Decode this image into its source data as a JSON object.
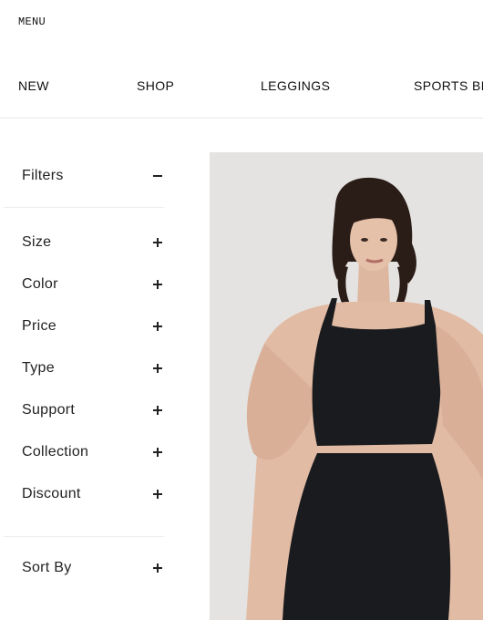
{
  "header": {
    "menu_label": "MENU"
  },
  "nav": {
    "items": [
      {
        "label": "NEW"
      },
      {
        "label": "SHOP"
      },
      {
        "label": "LEGGINGS"
      },
      {
        "label": "SPORTS BRAS"
      }
    ]
  },
  "filters": {
    "title": "Filters",
    "items": [
      {
        "label": "Size"
      },
      {
        "label": "Color"
      },
      {
        "label": "Price"
      },
      {
        "label": "Type"
      },
      {
        "label": "Support"
      },
      {
        "label": "Collection"
      },
      {
        "label": "Discount"
      }
    ],
    "sort_label": "Sort By"
  },
  "colors": {
    "background": "#ffffff",
    "text": "#111111",
    "divider": "#e8e8e8",
    "image_background": "#e4e3e1",
    "garment": "#1a1b1e"
  }
}
